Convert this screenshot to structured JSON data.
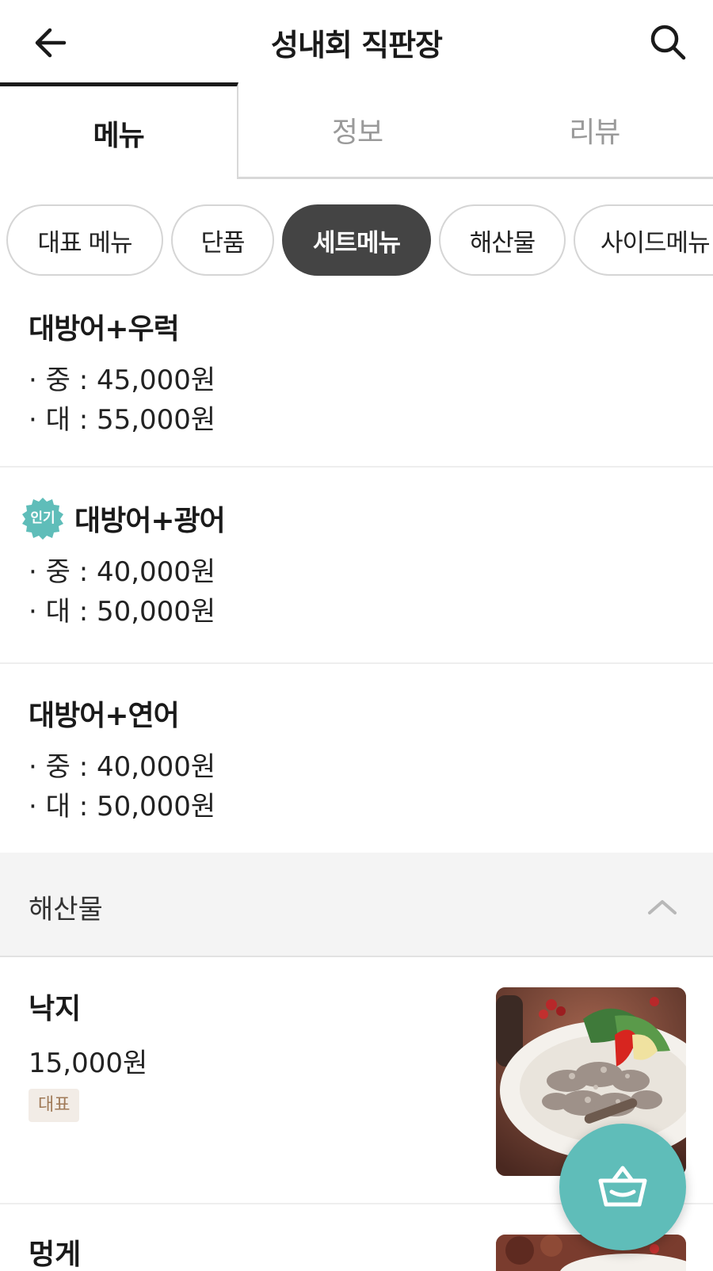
{
  "header": {
    "title": "성내회 직판장",
    "back_icon": "arrow-left-icon",
    "search_icon": "search-icon"
  },
  "tabs": [
    {
      "label": "메뉴",
      "active": true
    },
    {
      "label": "정보",
      "active": false
    },
    {
      "label": "리뷰",
      "active": false
    }
  ],
  "chips": [
    {
      "label": "대표 메뉴",
      "active": false
    },
    {
      "label": "단품",
      "active": false
    },
    {
      "label": "세트메뉴",
      "active": true
    },
    {
      "label": "해산물",
      "active": false
    },
    {
      "label": "사이드메뉴",
      "active": false
    }
  ],
  "set_menu": [
    {
      "name": "대방어+우럭",
      "popular": false,
      "prices": [
        "· 중 : 45,000원",
        "· 대 : 55,000원"
      ]
    },
    {
      "name": "대방어+광어",
      "popular": true,
      "badge": "인기",
      "prices": [
        "· 중 : 40,000원",
        "· 대 : 50,000원"
      ]
    },
    {
      "name": "대방어+연어",
      "popular": false,
      "prices": [
        "· 중 : 40,000원",
        "· 대 : 50,000원"
      ]
    }
  ],
  "section": {
    "label": "해산물",
    "collapse_icon": "chevron-up-icon"
  },
  "products": [
    {
      "name": "낙지",
      "price": "15,000원",
      "tag": "대표"
    },
    {
      "name": "멍게"
    }
  ],
  "cart_icon": "basket-icon",
  "colors": {
    "accent_teal": "#5fbdb9",
    "active_chip": "#444444",
    "tag_bg": "#f2ece6",
    "tag_text": "#a07a58"
  }
}
